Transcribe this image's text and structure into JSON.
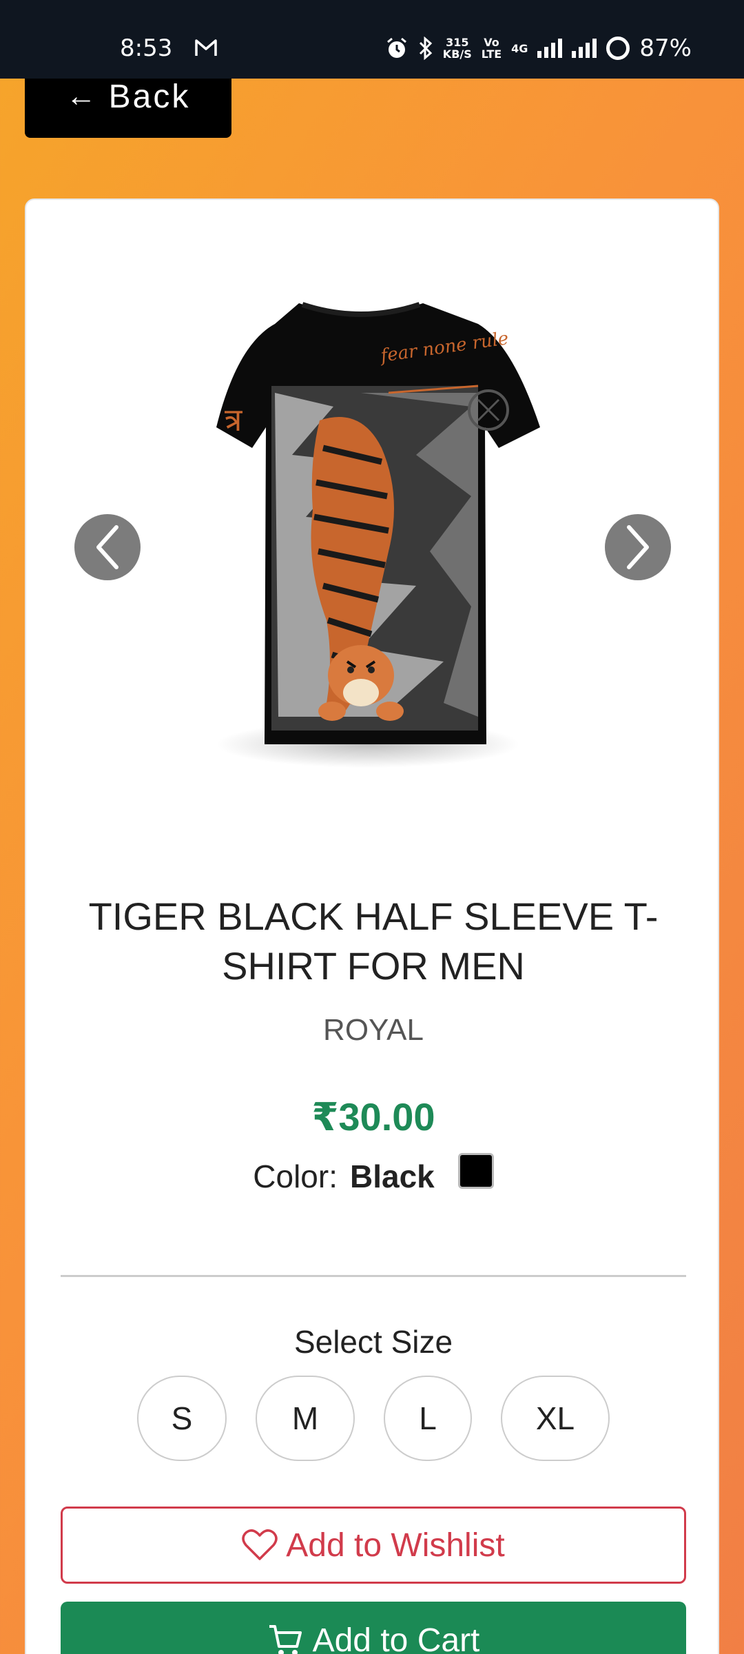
{
  "status_bar": {
    "time": "8:53",
    "speed_top": "315",
    "speed_bottom": "KB/S",
    "volte_top": "Vo",
    "volte_bottom": "LTE",
    "network": "4G",
    "battery": "87%"
  },
  "nav": {
    "back_label": "Back"
  },
  "product": {
    "title": "TIGER BLACK HALF SLEEVE T-SHIRT FOR MEN",
    "brand": "ROYAL",
    "price": "₹30.00",
    "color_label": "Color:",
    "color_value": "Black",
    "color_hex": "#000000",
    "print_text": "fear none rule"
  },
  "sizes": {
    "label": "Select Size",
    "options": [
      "S",
      "M",
      "L",
      "XL"
    ]
  },
  "actions": {
    "wishlist_label": "Add to Wishlist",
    "cart_label": "Add to Cart"
  },
  "colors": {
    "accent_price": "#1e8a57",
    "wishlist": "#d13b4b",
    "cart": "#1b8a55"
  }
}
